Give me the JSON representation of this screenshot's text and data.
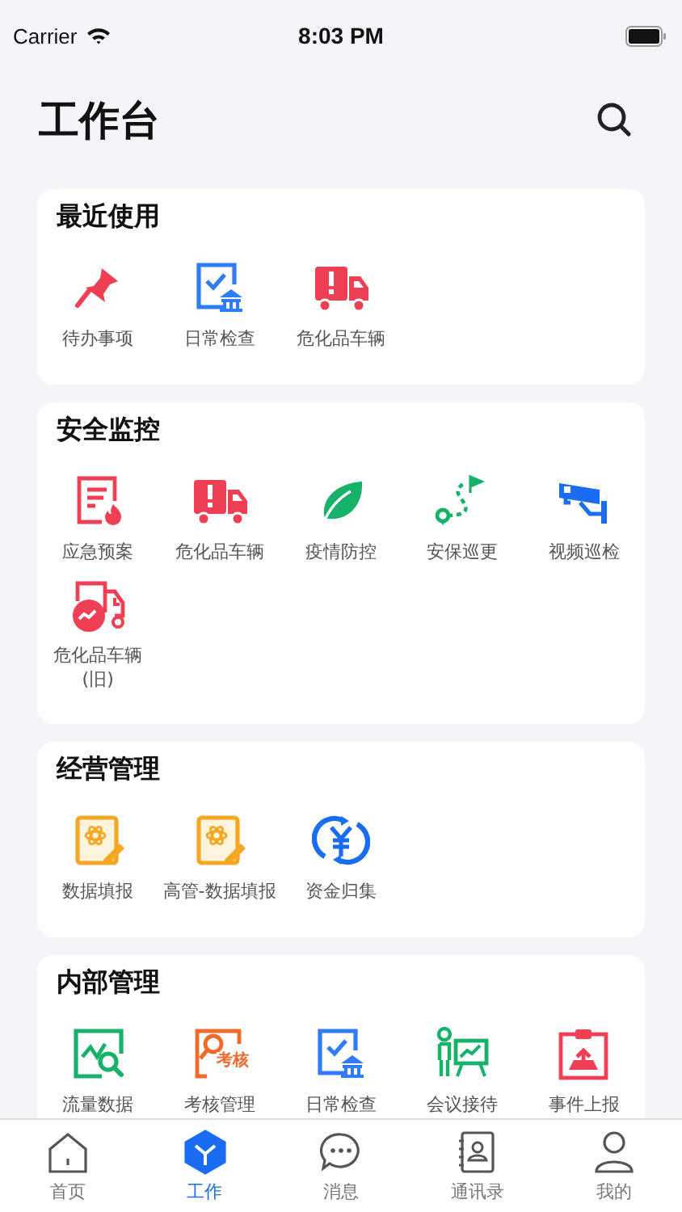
{
  "status_bar": {
    "carrier": "Carrier",
    "time": "8:03 PM"
  },
  "header": {
    "title": "工作台"
  },
  "sections": [
    {
      "title": "最近使用",
      "items": [
        {
          "label": "待办事项",
          "kind": "pin"
        },
        {
          "label": "日常检查",
          "kind": "inspect"
        },
        {
          "label": "危化品车辆",
          "kind": "truck"
        }
      ]
    },
    {
      "title": "安全监控",
      "items": [
        {
          "label": "应急预案",
          "kind": "plan"
        },
        {
          "label": "危化品车辆",
          "kind": "truck"
        },
        {
          "label": "疫情防控",
          "kind": "leaf"
        },
        {
          "label": "安保巡更",
          "kind": "patrol"
        },
        {
          "label": "视频巡检",
          "kind": "camera"
        },
        {
          "label": "危化品车辆\n(旧)",
          "kind": "truckold"
        }
      ]
    },
    {
      "title": "经营管理",
      "items": [
        {
          "label": "数据填报",
          "kind": "form"
        },
        {
          "label": "高管-数据填报",
          "kind": "form"
        },
        {
          "label": "资金归集",
          "kind": "yuan"
        }
      ]
    },
    {
      "title": "内部管理",
      "items": [
        {
          "label": "流量数据",
          "kind": "chartsearch"
        },
        {
          "label": "考核管理",
          "kind": "assess",
          "icon_text": "考核"
        },
        {
          "label": "日常检查",
          "kind": "inspect"
        },
        {
          "label": "会议接待",
          "kind": "meeting"
        },
        {
          "label": "事件上报",
          "kind": "report"
        }
      ]
    }
  ],
  "tabs": [
    {
      "label": "首页",
      "kind": "home",
      "selected": false
    },
    {
      "label": "工作",
      "kind": "work",
      "selected": true
    },
    {
      "label": "消息",
      "kind": "message",
      "selected": false
    },
    {
      "label": "通讯录",
      "kind": "contacts",
      "selected": false
    },
    {
      "label": "我的",
      "kind": "me",
      "selected": false
    }
  ]
}
